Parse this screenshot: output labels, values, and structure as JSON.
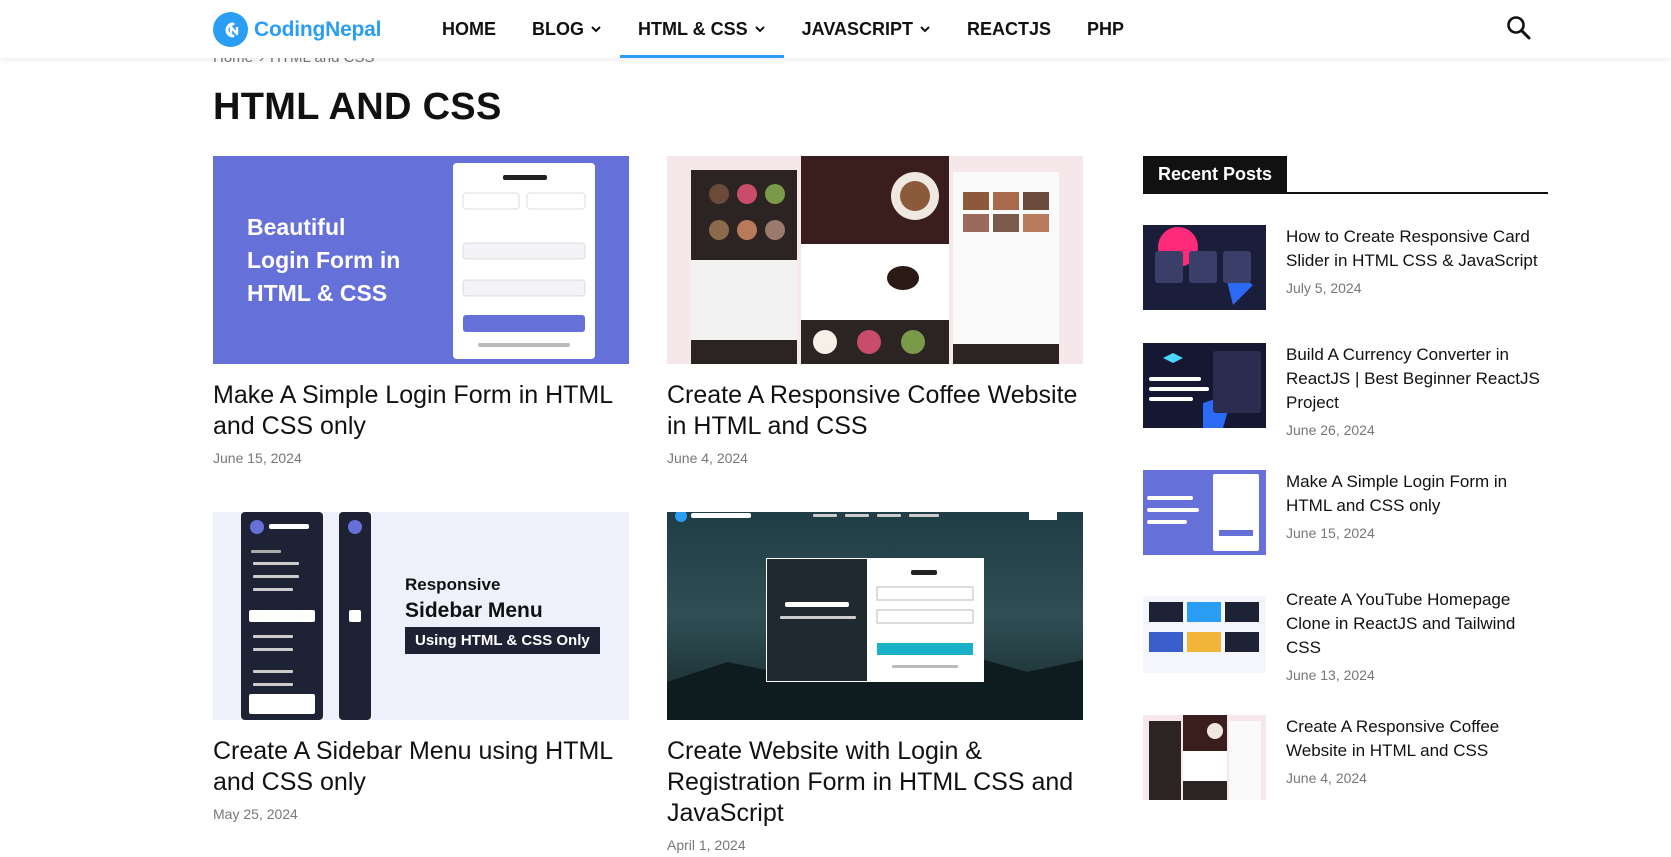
{
  "header": {
    "logo_text": "CodingNepal",
    "nav": [
      {
        "label": "HOME",
        "dropdown": false,
        "active": false
      },
      {
        "label": "BLOG",
        "dropdown": true,
        "active": false
      },
      {
        "label": "HTML & CSS",
        "dropdown": true,
        "active": true
      },
      {
        "label": "JAVASCRIPT",
        "dropdown": true,
        "active": false
      },
      {
        "label": "REACTJS",
        "dropdown": false,
        "active": false
      },
      {
        "label": "PHP",
        "dropdown": false,
        "active": false
      }
    ],
    "search_icon": "search-icon"
  },
  "breadcrumb": {
    "home": "Home",
    "separator": "›",
    "current": "HTML and CSS"
  },
  "page_title": "HTML AND CSS",
  "articles": [
    {
      "title": "Make A Simple Login Form in HTML and CSS only",
      "date": "June 15, 2024",
      "thumb_text": [
        "Beautiful",
        "Login Form in",
        "HTML & CSS"
      ]
    },
    {
      "title": "Create A Responsive Coffee Website in HTML and CSS",
      "date": "June 4, 2024"
    },
    {
      "title": "Create A Sidebar Menu using HTML and CSS only",
      "date": "May 25, 2024",
      "thumb_text": [
        "Responsive",
        "Sidebar Menu",
        "Using HTML & CSS Only"
      ]
    },
    {
      "title": "Create Website with Login & Registration Form in HTML CSS and JavaScript",
      "date": "April 1, 2024"
    }
  ],
  "sidebar": {
    "heading": "Recent Posts",
    "posts": [
      {
        "title": "How to Create Responsive Card Slider in HTML CSS & JavaScript",
        "date": "July 5, 2024"
      },
      {
        "title": "Build A Currency Converter in ReactJS | Best Beginner ReactJS Project",
        "date": "June 26, 2024"
      },
      {
        "title": "Make A Simple Login Form in HTML and CSS only",
        "date": "June 15, 2024"
      },
      {
        "title": "Create A YouTube Homepage Clone in ReactJS and Tailwind CSS",
        "date": "June 13, 2024"
      },
      {
        "title": "Create A Responsive Coffee Website in HTML and CSS",
        "date": "June 4, 2024"
      }
    ]
  },
  "colors": {
    "accent": "#2a9df4",
    "login_thumb": "#6570d9",
    "text": "#111111",
    "muted": "#777777"
  }
}
